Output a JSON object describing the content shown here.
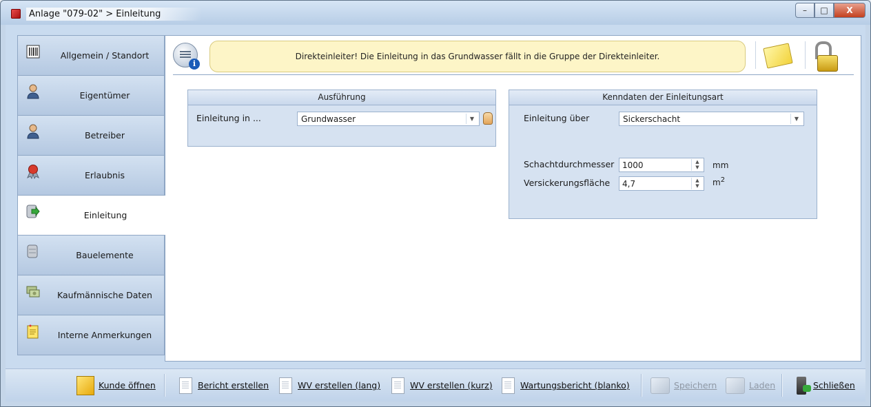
{
  "window": {
    "title": "Anlage \"079-02\" > Einleitung",
    "controls": {
      "minimize": "–",
      "maximize": "□",
      "close": "X"
    }
  },
  "sidebar": {
    "items": [
      {
        "label": "Allgemein / Standort",
        "icon": "barcode-icon",
        "active": false
      },
      {
        "label": "Eigentümer",
        "icon": "person-icon",
        "active": false
      },
      {
        "label": "Betreiber",
        "icon": "person-icon",
        "active": false
      },
      {
        "label": "Erlaubnis",
        "icon": "seal-icon",
        "active": false
      },
      {
        "label": "Einleitung",
        "icon": "database-arrow-icon",
        "active": true
      },
      {
        "label": "Bauelemente",
        "icon": "database-icon",
        "active": false
      },
      {
        "label": "Kaufmännische Daten",
        "icon": "money-icon",
        "active": false
      },
      {
        "label": "Interne Anmerkungen",
        "icon": "notepad-icon",
        "active": false
      }
    ]
  },
  "notice": {
    "text": "Direkteinleiter! Die Einleitung in das Grundwasser fällt in die Gruppe der Direkteinleiter."
  },
  "ausfuehrung": {
    "title": "Ausführung",
    "einleitung_in_label": "Einleitung in ...",
    "einleitung_in_value": "Grundwasser"
  },
  "kenndaten": {
    "title": "Kenndaten der Einleitungsart",
    "einleitung_ueber_label": "Einleitung über",
    "einleitung_ueber_value": "Sickerschacht",
    "schachtdurchmesser_label": "Schachtdurchmesser",
    "schachtdurchmesser_value": "1000",
    "schachtdurchmesser_unit": "mm",
    "versickerungsflaeche_label": "Versickerungsfläche",
    "versickerungsflaeche_value": "4,7",
    "versickerungsflaeche_unit_base": "m",
    "versickerungsflaeche_unit_exp": "2"
  },
  "toolbar": {
    "kunde_oeffnen": "Kunde öffnen",
    "bericht_erstellen": "Bericht erstellen",
    "wv_lang": "WV erstellen (lang)",
    "wv_kurz": "WV erstellen (kurz)",
    "wartungsbericht": "Wartungsbericht (blanko)",
    "speichern": "Speichern",
    "laden": "Laden",
    "schliessen": "Schließen"
  },
  "colors": {
    "accent": "#c9dbef",
    "notice_bg": "#fdf5c7",
    "close_button": "#c3401e"
  }
}
